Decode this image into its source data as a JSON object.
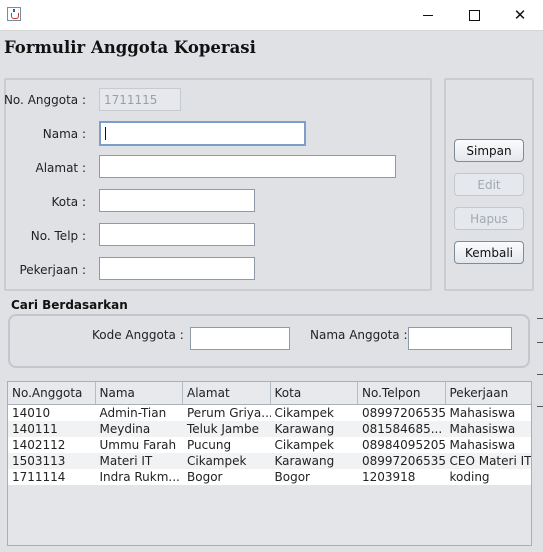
{
  "window": {
    "icon": "java-cup-icon",
    "controls": {
      "minimize": "minimize-icon",
      "maximize": "maximize-icon",
      "close": "✕"
    }
  },
  "form": {
    "title": "Formulir Anggota Koperasi",
    "fields": {
      "no_anggota": {
        "label": "No. Anggota :",
        "value": "1711115"
      },
      "nama": {
        "label": "Nama :",
        "value": ""
      },
      "alamat": {
        "label": "Alamat :",
        "value": ""
      },
      "kota": {
        "label": "Kota :",
        "value": ""
      },
      "no_telp": {
        "label": "No. Telp :",
        "value": ""
      },
      "pekerjaan": {
        "label": "Pekerjaan :",
        "value": ""
      }
    }
  },
  "buttons": {
    "simpan": "Simpan",
    "edit": "Edit",
    "hapus": "Hapus",
    "kembali": "Kembali"
  },
  "search": {
    "title": "Cari Berdasarkan",
    "kode_label": "Kode Anggota :",
    "kode_value": "",
    "nama_label": "Nama Anggota :",
    "nama_value": ""
  },
  "table": {
    "columns": [
      "No.Anggota",
      "Nama",
      "Alamat",
      "Kota",
      "No.Telpon",
      "Pekerjaan"
    ],
    "rows": [
      [
        "14010",
        "Admin-Tian",
        "Perum Griya...",
        "Cikampek",
        "08997206535",
        "Mahasiswa"
      ],
      [
        "140111",
        "Meydina",
        "Teluk Jambe",
        "Karawang",
        "081584685...",
        "Mahasiswa"
      ],
      [
        "1402112",
        "Ummu Farah",
        "Pucung",
        "Cikampek",
        "08984095205",
        "Mahasiswa"
      ],
      [
        "1503113",
        "Materi IT",
        "Cikampek",
        "Karawang",
        "08997206535",
        "CEO Materi IT"
      ],
      [
        "1711114",
        "Indra Rukm...",
        "Bogor",
        "Bogor",
        "1203918",
        "koding"
      ]
    ]
  }
}
